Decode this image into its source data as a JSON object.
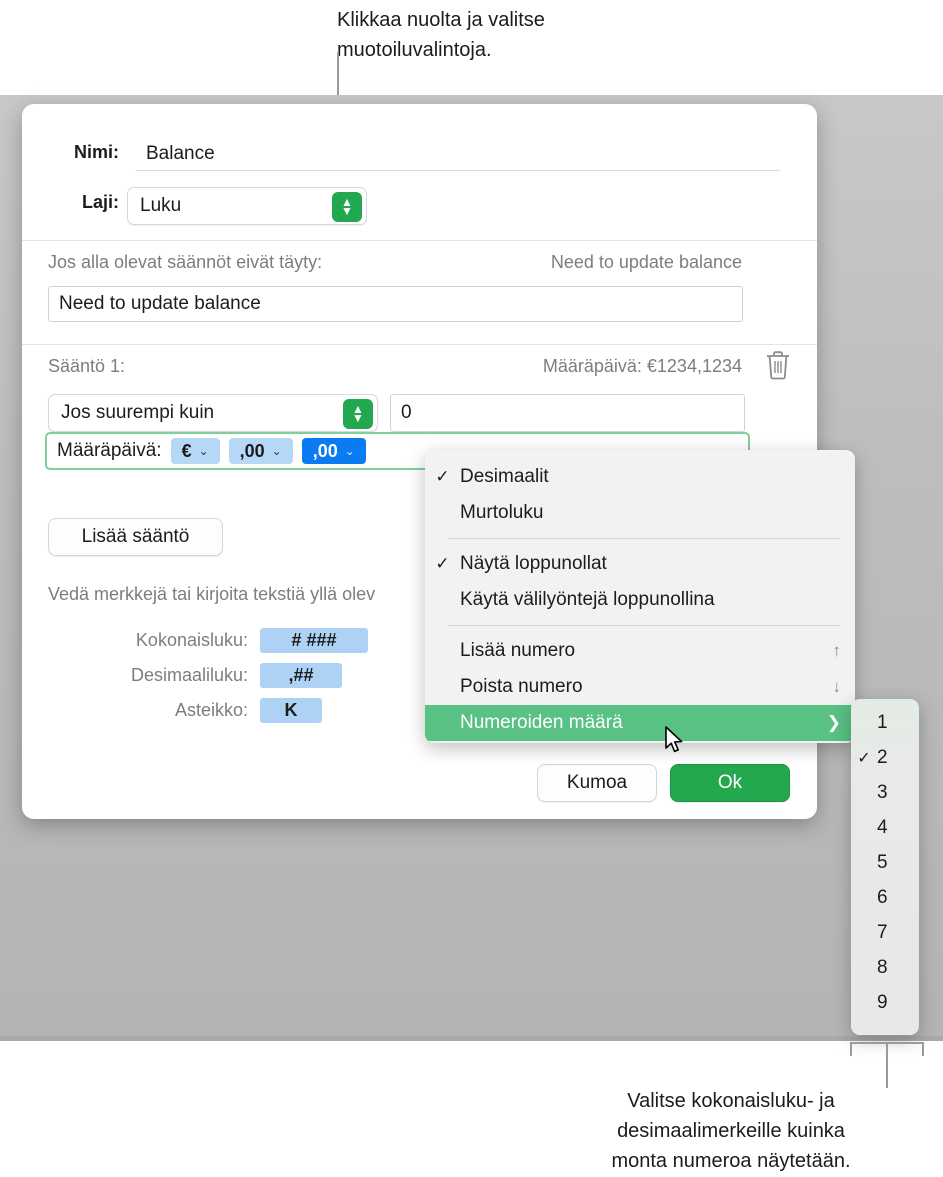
{
  "callouts": {
    "top": "Klikkaa nuolta ja valitse\nmuotoiluvalintoja.",
    "bottom": "Valitse kokonaisluku- ja\ndesimaalimerkeille kuinka\nmonta numeroa näytetään."
  },
  "dialog": {
    "name_label": "Nimi:",
    "name_value": "Balance",
    "kind_label": "Laji:",
    "kind_value": "Luku",
    "fallback_label": "Jos alla olevat säännöt eivät täyty:",
    "fallback_preview": "Need to update balance",
    "fallback_value": "Need to update balance",
    "rule_label": "Sääntö 1:",
    "rule_preview": "Määräpäivä: €1234,1234",
    "trash_icon": "trash-icon",
    "condition_value": "Jos suurempi kuin",
    "threshold_value": "0",
    "format_row": {
      "prefix": "Määräpäivä:",
      "tokens": [
        {
          "label": "€",
          "chevron": "⌄",
          "selected": false
        },
        {
          "label": ",00",
          "chevron": "⌄",
          "selected": false
        },
        {
          "label": ",00",
          "chevron": "⌄",
          "selected": true
        }
      ]
    },
    "add_rule_label": "Lisää sääntö",
    "hint": "Vedä merkkejä tai kirjoita tekstiä yllä olev",
    "fields": [
      {
        "label": "Kokonaisluku:",
        "token": "# ###"
      },
      {
        "label": "Desimaaliluku:",
        "token": ",##"
      },
      {
        "label": "Asteikko:",
        "token": "K"
      }
    ],
    "cancel_label": "Kumoa",
    "ok_label": "Ok"
  },
  "menu": {
    "items": [
      {
        "label": "Desimaalit",
        "checked": true,
        "accessory": "",
        "highlighted": false
      },
      {
        "label": "Murtoluku",
        "checked": false,
        "accessory": "",
        "highlighted": false
      },
      {
        "separator": true
      },
      {
        "label": "Näytä loppunollat",
        "checked": true,
        "accessory": "",
        "highlighted": false
      },
      {
        "label": "Käytä välilyöntejä loppunollina",
        "checked": false,
        "accessory": "",
        "highlighted": false
      },
      {
        "separator": true
      },
      {
        "label": "Lisää numero",
        "checked": false,
        "accessory": "↑",
        "highlighted": false
      },
      {
        "label": "Poista numero",
        "checked": false,
        "accessory": "↓",
        "highlighted": false
      },
      {
        "label": "Numeroiden määrä",
        "checked": false,
        "accessory": "❯",
        "highlighted": true
      }
    ],
    "check_glyph": "✓"
  },
  "submenu": {
    "check_glyph": "✓",
    "items": [
      {
        "label": "1",
        "checked": false
      },
      {
        "label": "2",
        "checked": true
      },
      {
        "label": "3",
        "checked": false
      },
      {
        "label": "4",
        "checked": false
      },
      {
        "label": "5",
        "checked": false
      },
      {
        "label": "6",
        "checked": false
      },
      {
        "label": "7",
        "checked": false
      },
      {
        "label": "8",
        "checked": false
      },
      {
        "label": "9",
        "checked": false
      }
    ]
  },
  "colors": {
    "accent_green": "#24a84e",
    "highlight_green": "#58c183",
    "token_blue": "#b6d8f7",
    "token_selected_blue": "#0a7bf0"
  }
}
